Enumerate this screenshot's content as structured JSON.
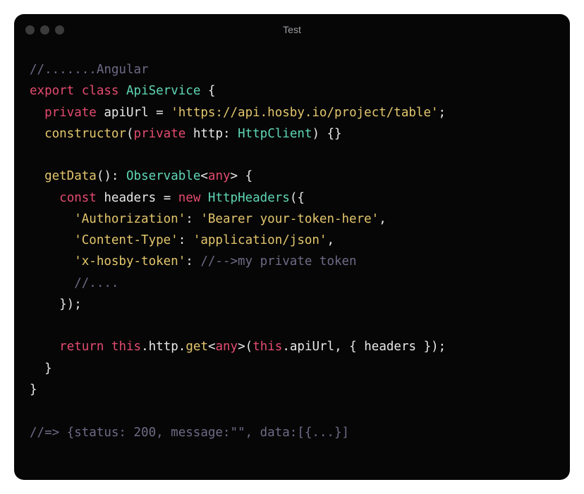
{
  "window": {
    "title": "Test"
  },
  "code": {
    "lines": [
      [
        {
          "cls": "tok-comment",
          "text": "//.......Angular"
        }
      ],
      [
        {
          "cls": "tok-keyword",
          "text": "export"
        },
        {
          "cls": "tok-punct",
          "text": " "
        },
        {
          "cls": "tok-keyword",
          "text": "class"
        },
        {
          "cls": "tok-punct",
          "text": " "
        },
        {
          "cls": "tok-class",
          "text": "ApiService"
        },
        {
          "cls": "tok-punct",
          "text": " {"
        }
      ],
      [
        {
          "cls": "tok-punct",
          "text": "  "
        },
        {
          "cls": "tok-keyword",
          "text": "private"
        },
        {
          "cls": "tok-punct",
          "text": " "
        },
        {
          "cls": "tok-property",
          "text": "apiUrl"
        },
        {
          "cls": "tok-punct",
          "text": " = "
        },
        {
          "cls": "tok-string",
          "text": "'https://api.hosby.io/project/table'"
        },
        {
          "cls": "tok-punct",
          "text": ";"
        }
      ],
      [
        {
          "cls": "tok-punct",
          "text": "  "
        },
        {
          "cls": "tok-method",
          "text": "constructor"
        },
        {
          "cls": "tok-punct",
          "text": "("
        },
        {
          "cls": "tok-keyword",
          "text": "private"
        },
        {
          "cls": "tok-punct",
          "text": " "
        },
        {
          "cls": "tok-param",
          "text": "http"
        },
        {
          "cls": "tok-punct",
          "text": ": "
        },
        {
          "cls": "tok-type",
          "text": "HttpClient"
        },
        {
          "cls": "tok-punct",
          "text": ") {}"
        }
      ],
      [
        {
          "cls": "tok-punct",
          "text": ""
        }
      ],
      [
        {
          "cls": "tok-punct",
          "text": "  "
        },
        {
          "cls": "tok-method",
          "text": "getData"
        },
        {
          "cls": "tok-punct",
          "text": "(): "
        },
        {
          "cls": "tok-type",
          "text": "Observable"
        },
        {
          "cls": "tok-generic",
          "text": "<"
        },
        {
          "cls": "tok-keyword",
          "text": "any"
        },
        {
          "cls": "tok-generic",
          "text": ">"
        },
        {
          "cls": "tok-punct",
          "text": " {"
        }
      ],
      [
        {
          "cls": "tok-punct",
          "text": "    "
        },
        {
          "cls": "tok-keyword",
          "text": "const"
        },
        {
          "cls": "tok-punct",
          "text": " "
        },
        {
          "cls": "tok-property",
          "text": "headers"
        },
        {
          "cls": "tok-punct",
          "text": " = "
        },
        {
          "cls": "tok-keyword",
          "text": "new"
        },
        {
          "cls": "tok-punct",
          "text": " "
        },
        {
          "cls": "tok-type",
          "text": "HttpHeaders"
        },
        {
          "cls": "tok-punct",
          "text": "({"
        }
      ],
      [
        {
          "cls": "tok-punct",
          "text": "      "
        },
        {
          "cls": "tok-string",
          "text": "'Authorization'"
        },
        {
          "cls": "tok-punct",
          "text": ": "
        },
        {
          "cls": "tok-string",
          "text": "'Bearer your-token-here'"
        },
        {
          "cls": "tok-punct",
          "text": ","
        }
      ],
      [
        {
          "cls": "tok-punct",
          "text": "      "
        },
        {
          "cls": "tok-string",
          "text": "'Content-Type'"
        },
        {
          "cls": "tok-punct",
          "text": ": "
        },
        {
          "cls": "tok-string",
          "text": "'application/json'"
        },
        {
          "cls": "tok-punct",
          "text": ","
        }
      ],
      [
        {
          "cls": "tok-punct",
          "text": "      "
        },
        {
          "cls": "tok-string",
          "text": "'x-hosby-token'"
        },
        {
          "cls": "tok-punct",
          "text": ": "
        },
        {
          "cls": "tok-comment",
          "text": "//-->my private token"
        }
      ],
      [
        {
          "cls": "tok-punct",
          "text": "      "
        },
        {
          "cls": "tok-comment",
          "text": "//...."
        }
      ],
      [
        {
          "cls": "tok-punct",
          "text": "    });"
        }
      ],
      [
        {
          "cls": "tok-punct",
          "text": ""
        }
      ],
      [
        {
          "cls": "tok-punct",
          "text": "    "
        },
        {
          "cls": "tok-keyword",
          "text": "return"
        },
        {
          "cls": "tok-punct",
          "text": " "
        },
        {
          "cls": "tok-this",
          "text": "this"
        },
        {
          "cls": "tok-punct",
          "text": "."
        },
        {
          "cls": "tok-property",
          "text": "http"
        },
        {
          "cls": "tok-punct",
          "text": "."
        },
        {
          "cls": "tok-method",
          "text": "get"
        },
        {
          "cls": "tok-generic",
          "text": "<"
        },
        {
          "cls": "tok-keyword",
          "text": "any"
        },
        {
          "cls": "tok-generic",
          "text": ">"
        },
        {
          "cls": "tok-punct",
          "text": "("
        },
        {
          "cls": "tok-this",
          "text": "this"
        },
        {
          "cls": "tok-punct",
          "text": "."
        },
        {
          "cls": "tok-property",
          "text": "apiUrl"
        },
        {
          "cls": "tok-punct",
          "text": ", { "
        },
        {
          "cls": "tok-property",
          "text": "headers"
        },
        {
          "cls": "tok-punct",
          "text": " });"
        }
      ],
      [
        {
          "cls": "tok-punct",
          "text": "  }"
        }
      ],
      [
        {
          "cls": "tok-punct",
          "text": "}"
        }
      ],
      [
        {
          "cls": "tok-punct",
          "text": ""
        }
      ],
      [
        {
          "cls": "tok-comment",
          "text": "//=> {status: 200, message:\"\", data:[{...}]"
        }
      ]
    ]
  }
}
